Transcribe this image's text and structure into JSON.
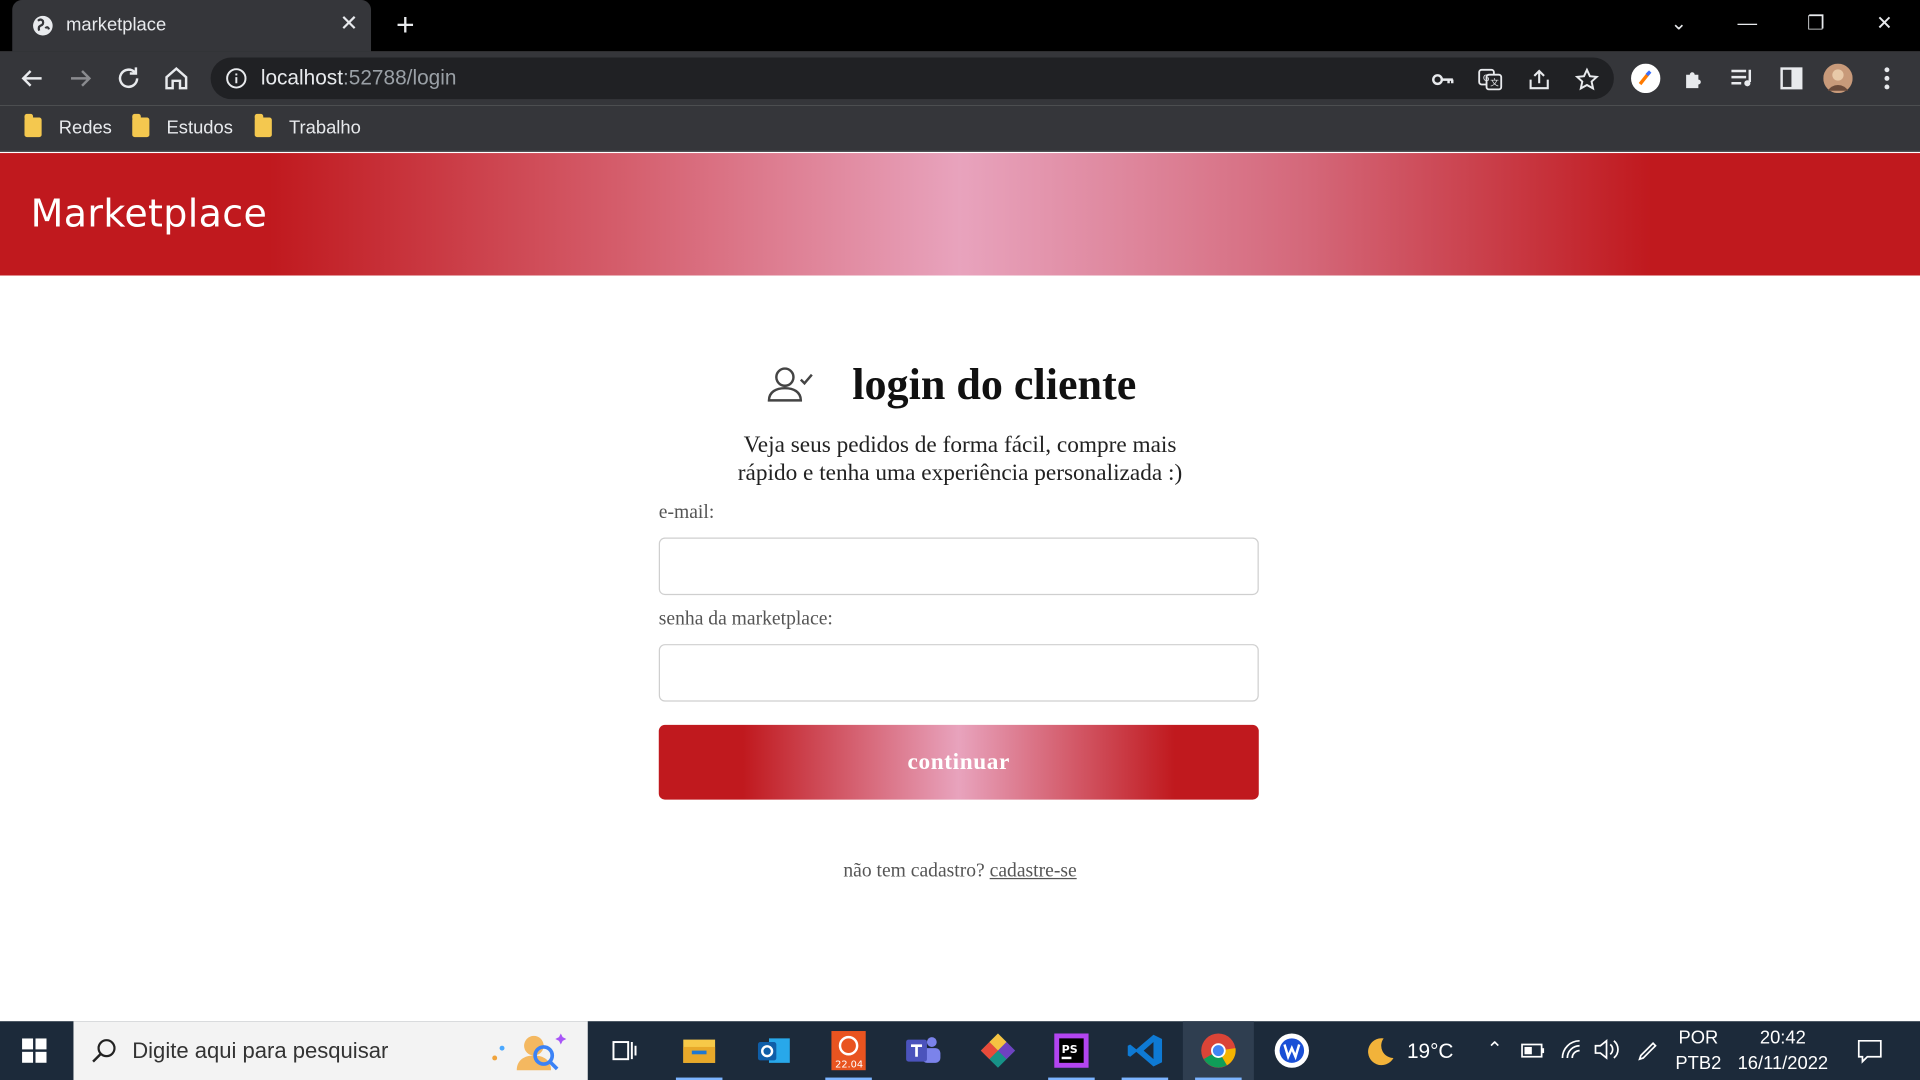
{
  "browser": {
    "tab_title": "marketplace",
    "url_host": "localhost",
    "url_path": ":52788/login",
    "bookmarks": [
      {
        "label": "Redes"
      },
      {
        "label": "Estudos"
      },
      {
        "label": "Trabalho"
      }
    ]
  },
  "page": {
    "brand": "Marketplace",
    "title": "login do cliente",
    "subtitle_line1": "Veja seus pedidos de forma fácil, compre mais",
    "subtitle_line2": "rápido e tenha uma experiência personalizada :)",
    "email_label": "e-mail:",
    "email_value": "",
    "password_label": "senha da marketplace:",
    "password_value": "",
    "continue_label": "continuar",
    "signup_prompt": "não tem cadastro?",
    "signup_link": "cadastre-se",
    "colors": {
      "brand_red": "#c0191e",
      "brand_pink": "#e8a3bd"
    }
  },
  "taskbar": {
    "search_placeholder": "Digite aqui para pesquisar",
    "ubuntu_badge": "22.04",
    "weather": "19°C",
    "language_top": "POR",
    "language_bottom": "PTB2",
    "time": "20:42",
    "date": "16/11/2022",
    "apps": [
      "task-view",
      "file-explorer",
      "outlook",
      "ubuntu",
      "teams",
      "gitkraken",
      "phpstorm",
      "vscode",
      "chrome",
      "app-blue"
    ]
  }
}
